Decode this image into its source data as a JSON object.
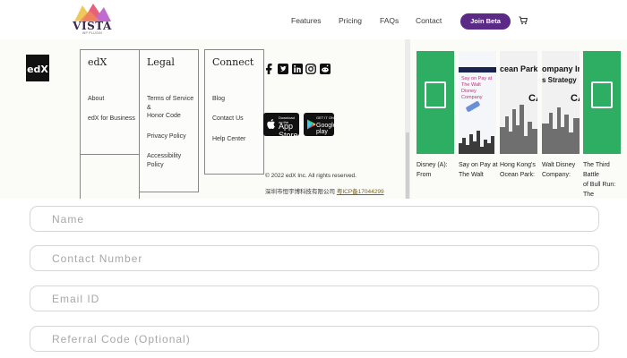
{
  "header": {
    "logo_text": "VISTA",
    "logo_sub": "WP PLUGIN",
    "nav": [
      "Features",
      "Pricing",
      "FAQs",
      "Contact"
    ],
    "cta_label": "Join Beta",
    "colors": {
      "cta": "#5b2a86"
    },
    "cart_icon": "cart-icon"
  },
  "embedded": {
    "edx_logo": "edX",
    "columns": [
      {
        "title": "edX",
        "links": [
          "About",
          "edX for Business"
        ]
      },
      {
        "title": "Legal",
        "links": [
          "Terms of Service &",
          "Honor Code",
          "Privacy Policy",
          "Accessibility Policy"
        ]
      },
      {
        "title": "Connect",
        "links": [
          "Blog",
          "Contact Us",
          "Help Center"
        ]
      }
    ],
    "social_icons": [
      "facebook-icon",
      "twitter-icon",
      "linkedin-icon",
      "instagram-icon",
      "reddit-icon"
    ],
    "app_store": {
      "small": "Download on the",
      "big": "App Store"
    },
    "google_play": {
      "small": "GET IT ON",
      "big": "Google play"
    },
    "copyright": "© 2022 edX Inc. All rights reserved.",
    "icp_prefix": "深圳市恒宇博科技有限公司",
    "icp_link": "粤ICP备17044299",
    "cards": [
      {
        "caption1": "Disney (A):",
        "caption2": "From",
        "cover": ""
      },
      {
        "caption1": "Say on Pay at",
        "caption2": "The Walt",
        "cover": "Say on Pay at The Walt Disney Company"
      },
      {
        "caption1": "Hong Kong's",
        "caption2": "Ocean Park:",
        "cover": "cean Park Ta"
      },
      {
        "caption1": "Walt Disney",
        "caption2": "Company:",
        "cover": "ompany Inve"
      },
      {
        "caption1": "The Third Battle",
        "caption2": "of Bull Run: The",
        "cover": ""
      }
    ]
  },
  "form": {
    "name_placeholder": "Name",
    "contact_placeholder": "Contact Number",
    "email_placeholder": "Email ID",
    "referral_placeholder": "Referral Code (Optional)"
  }
}
